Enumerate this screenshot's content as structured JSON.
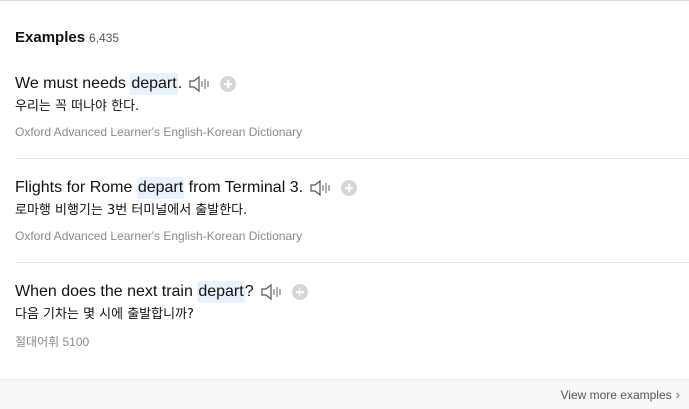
{
  "header": {
    "title": "Examples",
    "count": "6,435"
  },
  "examples": [
    {
      "sentence_before": "We must needs ",
      "keyword": "depart",
      "sentence_after": ".",
      "translation": "우리는 꼭 떠나야 한다.",
      "source": "Oxford Advanced Learner's English-Korean Dictionary"
    },
    {
      "sentence_before": "Flights for Rome ",
      "keyword": "depart",
      "sentence_after": " from Terminal 3.",
      "translation": "로마행 비행기는 3번 터미널에서 출발한다.",
      "source": "Oxford Advanced Learner's English-Korean Dictionary"
    },
    {
      "sentence_before": "When does the next train ",
      "keyword": "depart",
      "sentence_after": "?",
      "translation": "다음 기차는 몇 시에 출발합니까?",
      "source": "절대어휘 5100"
    }
  ],
  "footer": {
    "view_more": "View more examples",
    "chevron": "›"
  },
  "icons": {
    "speaker": "speaker-icon",
    "add": "plus-circle-icon"
  },
  "colors": {
    "highlight": "#e8f2fc",
    "icon_gray": "#d6d6d6"
  }
}
